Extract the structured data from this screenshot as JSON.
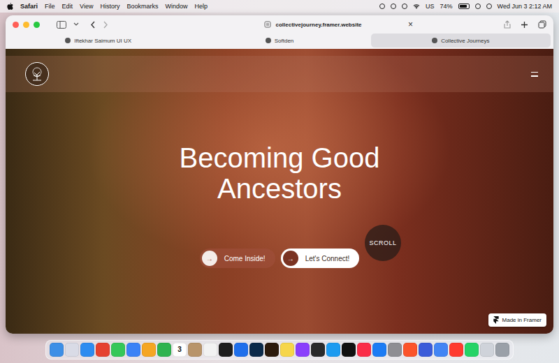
{
  "menu_bar": {
    "app": "Safari",
    "items": [
      "File",
      "Edit",
      "View",
      "History",
      "Bookmarks",
      "Window",
      "Help"
    ],
    "input_source": "US",
    "battery": "74%",
    "battery_level": 0.74,
    "clock": "Wed Jun 3  2:12 AM"
  },
  "toolbar": {
    "address": "collectivejourney.framer.website",
    "close": "×"
  },
  "tabs": [
    {
      "label": "Iftekhar Saimum UI UX",
      "selected": false
    },
    {
      "label": "Softden",
      "selected": false
    },
    {
      "label": "Collective Journeys",
      "selected": true
    }
  ],
  "page": {
    "title": "Becoming Good Ancestors",
    "buttons": [
      {
        "label": "Come Inside!",
        "arrow": "→",
        "kind": "ghost"
      },
      {
        "label": "Let's Connect!",
        "arrow": "→",
        "kind": "solid"
      }
    ],
    "scroll": "SCROLL",
    "badge": "Made in Framer"
  },
  "dock": [
    {
      "kind": "app",
      "color": "#3d8fe6"
    },
    {
      "kind": "app",
      "color": "#d9dbe6"
    },
    {
      "kind": "app",
      "color": "#2d8cf0"
    },
    {
      "kind": "app",
      "color": "#e5412f"
    },
    {
      "kind": "app",
      "color": "#34c759"
    },
    {
      "kind": "app",
      "color": "#3b82f6"
    },
    {
      "kind": "app",
      "color": "#f5a623"
    },
    {
      "kind": "app",
      "color": "#2fb350"
    },
    {
      "kind": "calendar",
      "color": "#ffffff",
      "label": "3"
    },
    {
      "kind": "app",
      "color": "#b8946a"
    },
    {
      "kind": "app",
      "color": "#f2f2f2"
    },
    {
      "kind": "app",
      "color": "#1e1e1e"
    },
    {
      "kind": "app",
      "color": "#1f6feb"
    },
    {
      "kind": "app",
      "color": "#0b2a4a"
    },
    {
      "kind": "app",
      "color": "#2b1a0c"
    },
    {
      "kind": "app",
      "color": "#f6d64a"
    },
    {
      "kind": "app",
      "color": "#8a3ffc"
    },
    {
      "kind": "app",
      "color": "#2a2a2a"
    },
    {
      "kind": "app",
      "color": "#1d9bf0"
    },
    {
      "kind": "app",
      "color": "#111111"
    },
    {
      "kind": "app",
      "color": "#fa2d48"
    },
    {
      "kind": "app",
      "color": "#1c7cf4"
    },
    {
      "kind": "app",
      "color": "#8e8e93"
    },
    {
      "kind": "app",
      "color": "#fb542b"
    },
    {
      "kind": "app",
      "color": "#3a5bd9"
    },
    {
      "kind": "app",
      "color": "#4285f4"
    },
    {
      "kind": "app",
      "color": "#ff3b30"
    },
    {
      "kind": "app",
      "color": "#25d366"
    },
    {
      "kind": "app",
      "color": "#cfd3da"
    },
    {
      "kind": "app",
      "color": "#9aa0a8"
    }
  ]
}
